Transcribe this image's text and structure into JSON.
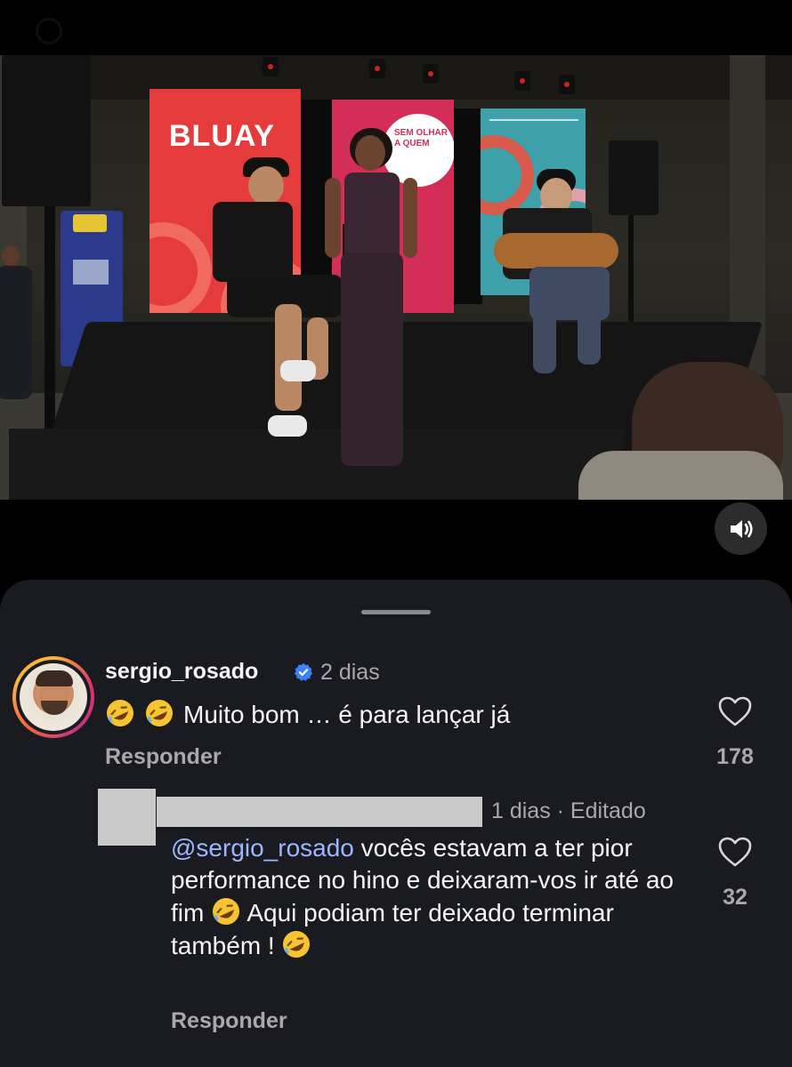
{
  "video": {
    "stage_screen_brand": "BLUAY",
    "stage_screen_slogan": "SEM OLHAR A QUEM",
    "mute_icon": "speaker-volume-icon"
  },
  "comments": [
    {
      "username": "sergio_rosado",
      "verified": true,
      "time": "2 dias",
      "text": "Muito bom … é para lançar já",
      "emoji": "rolling-on-floor-laughing",
      "reply_label": "Responder",
      "likes": "178"
    },
    {
      "username_redacted": true,
      "time": "1 dias · Editado",
      "mention": "@sergio_rosado",
      "text_part1": " vocês estavam a ter pior performance no hino e deixaram-vos ir até ao fim ",
      "text_part2": " Aqui podiam ter deixado terminar também ! ",
      "reply_label": "Responder",
      "likes": "32"
    }
  ],
  "colors": {
    "sheet_bg": "#1a1b20",
    "muted_text": "#a8a8ad",
    "mention": "#9bb7ff",
    "verified": "#3b82f6"
  }
}
